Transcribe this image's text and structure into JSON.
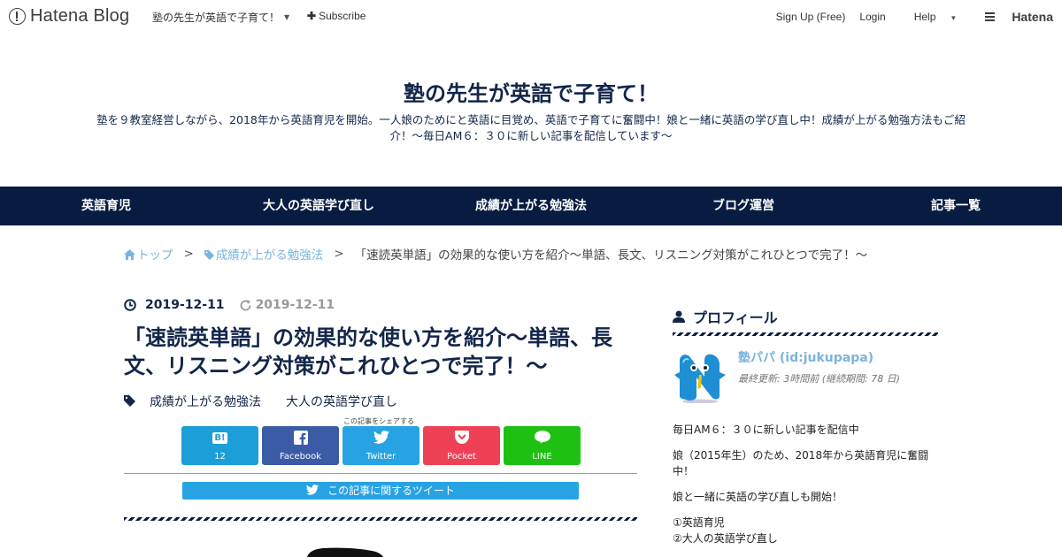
{
  "topbar": {
    "logo_text": "Hatena Blog",
    "blog_name": "塾の先生が英語で子育て！",
    "subscribe": "Subscribe",
    "signup": "Sign Up (Free)",
    "login": "Login",
    "help": "Help",
    "hatena": "Hatena"
  },
  "header": {
    "title": "塾の先生が英語で子育て！",
    "description": "塾を９教室経営しながら、2018年から英語育児を開始。一人娘のためにと英語に目覚め、英語で子育てに奮闘中！娘と一緒に英語の学び直し中！成績が上がる勉強方法もご紹介！～毎日AM６：３０に新しい記事を配信しています～"
  },
  "nav": {
    "items": [
      {
        "label": "英語育児"
      },
      {
        "label": "大人の英語学び直し"
      },
      {
        "label": "成績が上がる勉強法"
      },
      {
        "label": "ブログ運営"
      },
      {
        "label": "記事一覧"
      }
    ]
  },
  "breadcrumb": {
    "home": "トップ",
    "category": "成績が上がる勉強法",
    "current": "「速読英単語」の効果的な使い方を紹介～単語、長文、リスニング対策がこれひとつで完了！～",
    "separator": ">"
  },
  "article": {
    "published": "2019-12-11",
    "updated": "2019-12-11",
    "title": "「速読英単語」の効果的な使い方を紹介～単語、長文、リスニング対策がこれひとつで完了！～",
    "categories": [
      "成績が上がる勉強法",
      "大人の英語学び直し"
    ],
    "share_label": "この記事をシェアする",
    "share_buttons": [
      {
        "icon": "B!",
        "label": "12"
      },
      {
        "icon": "f",
        "label": "Facebook"
      },
      {
        "icon": "t",
        "label": "Twitter"
      },
      {
        "icon": "p",
        "label": "Pocket"
      },
      {
        "icon": "l",
        "label": "LINE"
      }
    ],
    "tweet_button": "この記事に関するツイート"
  },
  "sidebar": {
    "profile_heading": "プロフィール",
    "name": "塾パパ (id:jukupapa)",
    "updated": "最終更新: 3時間前 (継続期間: 78 日)",
    "bio": [
      "毎日AM６：３０に新しい記事を配信中",
      "娘（2015年生）のため、2018年から英語育児に奮闘中！",
      "娘と一緒に英語の学び直しも開始！",
      "①英語育児",
      "②大人の英語学び直し"
    ]
  }
}
